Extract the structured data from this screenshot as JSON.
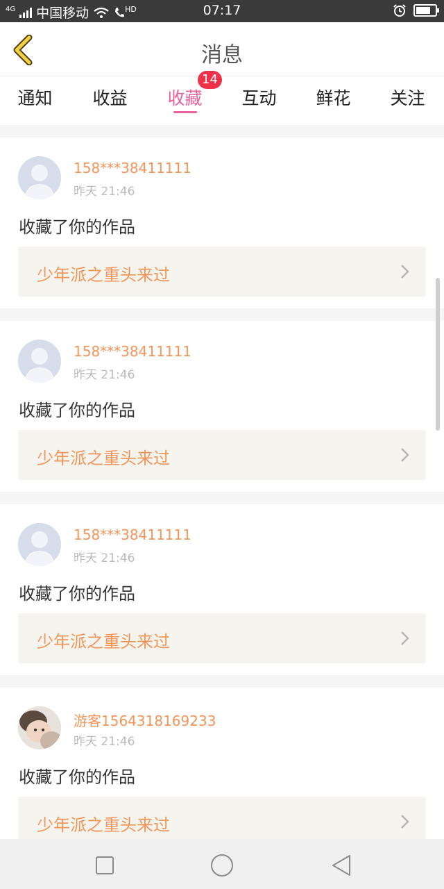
{
  "status_bar": {
    "network": "4G",
    "carrier": "中国移动",
    "hd": "HD",
    "time": "07:17"
  },
  "header": {
    "title": "消息",
    "back_icon": "chevron-left-icon"
  },
  "tabs": [
    {
      "label": "通知",
      "active": false
    },
    {
      "label": "收益",
      "active": false
    },
    {
      "label": "收藏",
      "active": true,
      "badge": "14"
    },
    {
      "label": "互动",
      "active": false
    },
    {
      "label": "鲜花",
      "active": false
    },
    {
      "label": "关注",
      "active": false
    }
  ],
  "colors": {
    "accent": "#e8629c",
    "badge": "#f0314a",
    "username": "#f2955a",
    "work_bg": "#f5f4ee"
  },
  "messages": [
    {
      "username": "158***38411111",
      "time": "昨天 21:46",
      "action": "收藏了你的作品",
      "work_title": "少年派之重头来过",
      "avatar": "default-avatar"
    },
    {
      "username": "158***38411111",
      "time": "昨天 21:46",
      "action": "收藏了你的作品",
      "work_title": "少年派之重头来过",
      "avatar": "default-avatar"
    },
    {
      "username": "158***38411111",
      "time": "昨天 21:46",
      "action": "收藏了你的作品",
      "work_title": "少年派之重头来过",
      "avatar": "default-avatar"
    },
    {
      "username": "游客1564318169233",
      "time": "昨天 21:46",
      "action": "收藏了你的作品",
      "work_title": "少年派之重头来过",
      "avatar": "photo-avatar"
    }
  ],
  "nav_bar": [
    "recent-apps-icon",
    "home-icon",
    "back-icon"
  ]
}
